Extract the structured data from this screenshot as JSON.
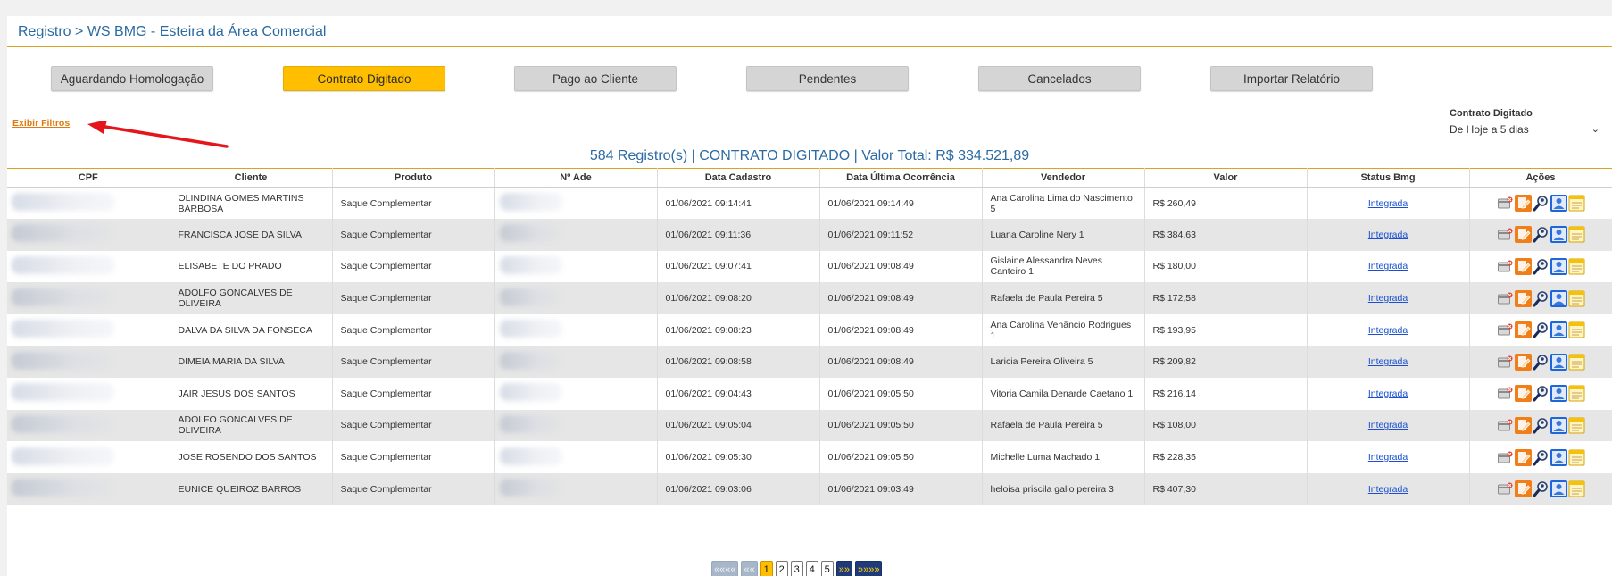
{
  "breadcrumb": "Registro > WS BMG - Esteira da Área Comercial",
  "stage_buttons": [
    {
      "label": "Aguardando Homologação",
      "active": false
    },
    {
      "label": "Contrato Digitado",
      "active": true
    },
    {
      "label": "Pago ao Cliente",
      "active": false
    },
    {
      "label": "Pendentes",
      "active": false
    },
    {
      "label": "Cancelados",
      "active": false
    },
    {
      "label": "Importar Relatório",
      "active": false
    }
  ],
  "filters_link": "Exibir Filtros",
  "period": {
    "label": "Contrato Digitado",
    "value": "De Hoje a 5 dias"
  },
  "summary": "584 Registro(s) | CONTRATO DIGITADO | Valor Total: R$ 334.521,89",
  "table": {
    "columns": [
      "CPF",
      "Cliente",
      "Produto",
      "Nº Ade",
      "Data Cadastro",
      "Data Última Ocorrência",
      "Vendedor",
      "Valor",
      "Status Bmg",
      "Ações"
    ],
    "rows": [
      {
        "cliente": "OLINDINA GOMES MARTINS BARBOSA",
        "produto": "Saque Complementar",
        "data_cadastro": "01/06/2021 09:14:41",
        "data_ocorrencia": "01/06/2021 09:14:49",
        "vendedor": "Ana Carolina Lima do Nascimento 5",
        "valor": "R$ 260,49",
        "status": "Integrada"
      },
      {
        "cliente": "FRANCISCA JOSE DA SILVA",
        "produto": "Saque Complementar",
        "data_cadastro": "01/06/2021 09:11:36",
        "data_ocorrencia": "01/06/2021 09:11:52",
        "vendedor": "Luana Caroline Nery 1",
        "valor": "R$ 384,63",
        "status": "Integrada"
      },
      {
        "cliente": "ELISABETE DO PRADO",
        "produto": "Saque Complementar",
        "data_cadastro": "01/06/2021 09:07:41",
        "data_ocorrencia": "01/06/2021 09:08:49",
        "vendedor": "Gislaine Alessandra Neves Canteiro 1",
        "valor": "R$ 180,00",
        "status": "Integrada"
      },
      {
        "cliente": "ADOLFO GONCALVES DE OLIVEIRA",
        "produto": "Saque Complementar",
        "data_cadastro": "01/06/2021 09:08:20",
        "data_ocorrencia": "01/06/2021 09:08:49",
        "vendedor": "Rafaela de Paula Pereira 5",
        "valor": "R$ 172,58",
        "status": "Integrada"
      },
      {
        "cliente": "DALVA DA SILVA DA FONSECA",
        "produto": "Saque Complementar",
        "data_cadastro": "01/06/2021 09:08:23",
        "data_ocorrencia": "01/06/2021 09:08:49",
        "vendedor": "Ana Carolina Venâncio Rodrigues 1",
        "valor": "R$ 193,95",
        "status": "Integrada"
      },
      {
        "cliente": "DIMEIA MARIA DA SILVA",
        "produto": "Saque Complementar",
        "data_cadastro": "01/06/2021 09:08:58",
        "data_ocorrencia": "01/06/2021 09:08:49",
        "vendedor": "Laricia Pereira Oliveira 5",
        "valor": "R$ 209,82",
        "status": "Integrada"
      },
      {
        "cliente": "JAIR JESUS DOS SANTOS",
        "produto": "Saque Complementar",
        "data_cadastro": "01/06/2021 09:04:43",
        "data_ocorrencia": "01/06/2021 09:05:50",
        "vendedor": "Vitoria Camila Denarde Caetano 1",
        "valor": "R$ 216,14",
        "status": "Integrada"
      },
      {
        "cliente": "ADOLFO GONCALVES DE OLIVEIRA",
        "produto": "Saque Complementar",
        "data_cadastro": "01/06/2021 09:05:04",
        "data_ocorrencia": "01/06/2021 09:05:50",
        "vendedor": "Rafaela de Paula Pereira 5",
        "valor": "R$ 108,00",
        "status": "Integrada"
      },
      {
        "cliente": "JOSE ROSENDO DOS SANTOS",
        "produto": "Saque Complementar",
        "data_cadastro": "01/06/2021 09:05:30",
        "data_ocorrencia": "01/06/2021 09:05:50",
        "vendedor": "Michelle Luma Machado 1",
        "valor": "R$ 228,35",
        "status": "Integrada"
      },
      {
        "cliente": "EUNICE QUEIROZ BARROS",
        "produto": "Saque Complementar",
        "data_cadastro": "01/06/2021 09:03:06",
        "data_ocorrencia": "01/06/2021 09:03:49",
        "vendedor": "heloisa priscila galio pereira 3",
        "valor": "R$ 407,30",
        "status": "Integrada"
      }
    ],
    "row_actions": [
      "card-remove-icon",
      "edit-document-icon",
      "search-user-icon",
      "user-profile-icon",
      "notes-icon"
    ]
  },
  "pagination": {
    "first": "««««",
    "prev": "««",
    "pages": [
      "1",
      "2",
      "3",
      "4",
      "5"
    ],
    "current": "1",
    "next": "»»",
    "last": "»»»»"
  },
  "colors": {
    "accent_yellow": "#ffbf00",
    "title_blue": "#2b6aa3",
    "rule_gold": "#d9a520",
    "link_orange": "#e07a10",
    "annotation_red": "#e5161b"
  }
}
